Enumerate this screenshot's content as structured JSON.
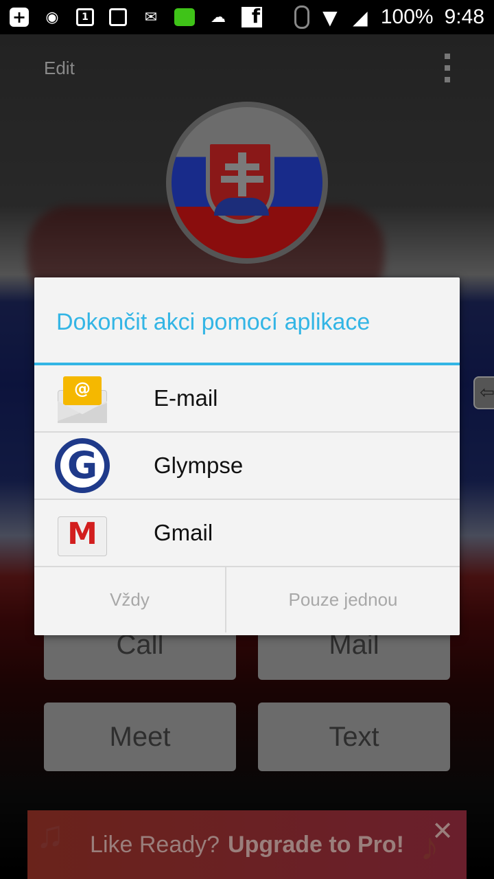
{
  "status_bar": {
    "battery": "100%",
    "time": "9:48",
    "left_icons": [
      "plus-icon",
      "messenger-icon",
      "calendar-icon",
      "gallery-icon",
      "gmail-notification-icon",
      "chat-icon",
      "weather-icon",
      "facebook-icon"
    ],
    "calendar_day": "1"
  },
  "app": {
    "header_label": "Edit",
    "buttons": {
      "call": "Call",
      "mail": "Mail",
      "meet": "Meet",
      "text": "Text"
    },
    "banner": {
      "lead": "Like Ready?",
      "cta": "Upgrade to Pro!"
    }
  },
  "dialog": {
    "title": "Dokončit akci pomocí aplikace",
    "options": [
      {
        "label": "E-mail",
        "icon": "email-app-icon"
      },
      {
        "label": "Glympse",
        "icon": "glympse-app-icon"
      },
      {
        "label": "Gmail",
        "icon": "gmail-app-icon"
      }
    ],
    "actions": {
      "always": "Vždy",
      "just_once": "Pouze jednou"
    }
  },
  "colors": {
    "accent": "#33b5e5",
    "dialog_bg": "#f3f3f3"
  }
}
